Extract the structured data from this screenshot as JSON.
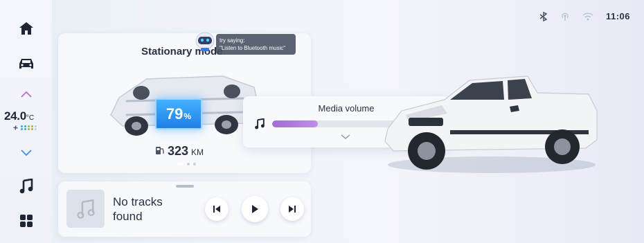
{
  "status_bar": {
    "bluetooth_icon": "bluetooth-icon",
    "hotspot_icon": "hotspot-icon",
    "wifi_icon": "wifi-icon",
    "time": "11:06"
  },
  "sidebar": {
    "items": [
      {
        "icon": "home-icon"
      },
      {
        "icon": "car-icon"
      },
      {
        "icon": "chevron-up-icon"
      },
      {
        "icon": "chevron-down-icon"
      },
      {
        "icon": "music-note-icon"
      },
      {
        "icon": "apps-grid-icon"
      }
    ],
    "temperature": "24.0",
    "temperature_unit": "°C",
    "fan_icon": "fan-icon"
  },
  "vehicle_card": {
    "title": "Stationary mode",
    "battery_percent": "79",
    "battery_unit": "%",
    "range_value": "323",
    "range_unit": "KM",
    "page_count": 3,
    "active_page": 0
  },
  "assistant": {
    "icon": "robot-assistant-icon",
    "tip_line1": "try saying:",
    "tip_line2": "\"Listen to Bluetooth music\""
  },
  "volume_popup": {
    "title": "Media volume",
    "value": "12",
    "fill_fraction": 0.3,
    "accent_color": "#b07be0"
  },
  "music_card": {
    "track_title": "No tracks found",
    "prev_icon": "skip-previous-icon",
    "play_icon": "play-icon",
    "next_icon": "skip-next-icon"
  }
}
